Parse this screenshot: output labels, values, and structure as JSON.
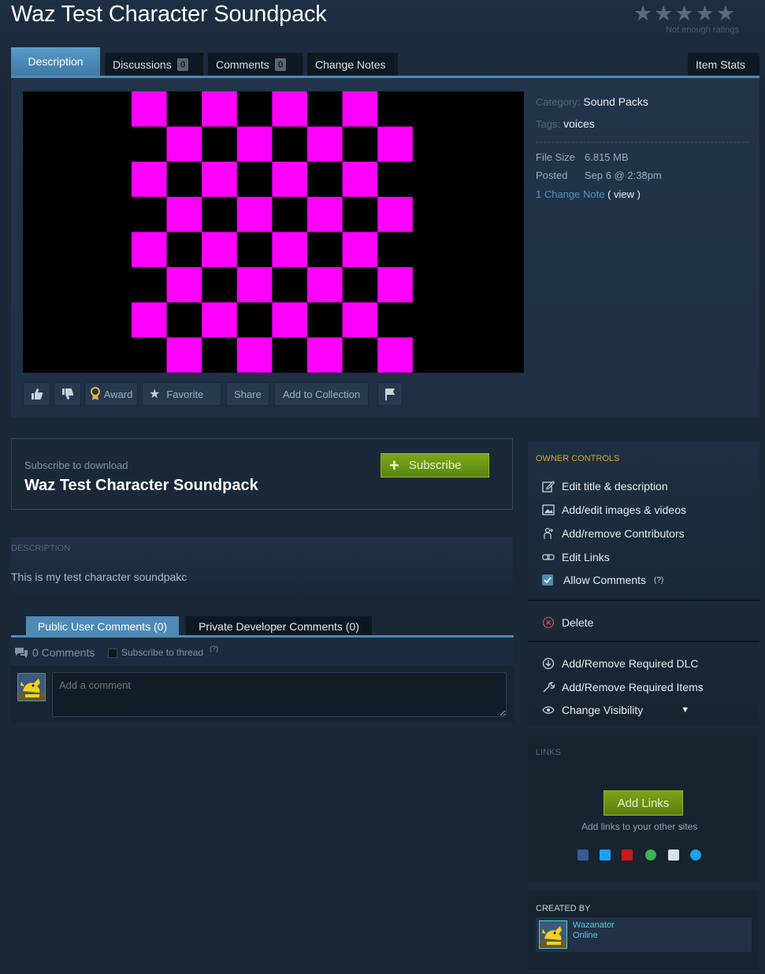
{
  "page": {
    "title": "Waz Test Character Soundpack",
    "rating_stars": "★★★★★",
    "rating_note": "Not enough ratings"
  },
  "tabs": {
    "description": "Description",
    "discussions": "Discussions",
    "discussions_count": "0",
    "comments": "Comments",
    "comments_count": "0",
    "change_notes": "Change Notes",
    "item_stats": "Item Stats"
  },
  "meta": {
    "category_label": "Category:",
    "category_value": "Sound Packs",
    "tags_label": "Tags:",
    "tags_value": "voices",
    "file_size_label": "File Size",
    "file_size_value": "6.815 MB",
    "posted_label": "Posted",
    "posted_value": "Sep 6 @ 2:38pm",
    "change_note_link": "1 Change Note",
    "change_note_view": "( view )"
  },
  "actions": {
    "award": "Award",
    "favorite": "Favorite",
    "share": "Share",
    "add_to_collection": "Add to Collection"
  },
  "subscribe": {
    "label": "Subscribe to download",
    "name": "Waz Test Character Soundpack",
    "button": "Subscribe"
  },
  "description": {
    "heading": "DESCRIPTION",
    "text": "This is my test character soundpakc"
  },
  "comments": {
    "public_tab": "Public User Comments (0)",
    "private_tab": "Private Developer Comments (0)",
    "count": "0 Comments",
    "subscribe_thread": "Subscribe to thread",
    "help": "(?)",
    "placeholder": "Add a comment"
  },
  "owner": {
    "title": "OWNER CONTROLS",
    "edit_title": "Edit title & description",
    "edit_images": "Add/edit images & videos",
    "contributors": "Add/remove Contributors",
    "edit_links": "Edit Links",
    "allow_comments": "Allow Comments",
    "allow_help": "(?)",
    "delete": "Delete",
    "required_dlc": "Add/Remove Required DLC",
    "required_items": "Add/Remove Required Items",
    "visibility": "Change Visibility"
  },
  "links": {
    "title": "LINKS",
    "button": "Add Links",
    "subtitle": "Add links to your other sites"
  },
  "creator": {
    "title": "CREATED BY",
    "name": "Wazanator",
    "status": "Online"
  },
  "colors": {
    "background": "#1b2838",
    "accent": "#4d8ab5",
    "subscribe_green": "#79a818",
    "checker_magenta": "#ff00ff",
    "owner_title": "#d4a72c",
    "online": "#57cbde"
  }
}
